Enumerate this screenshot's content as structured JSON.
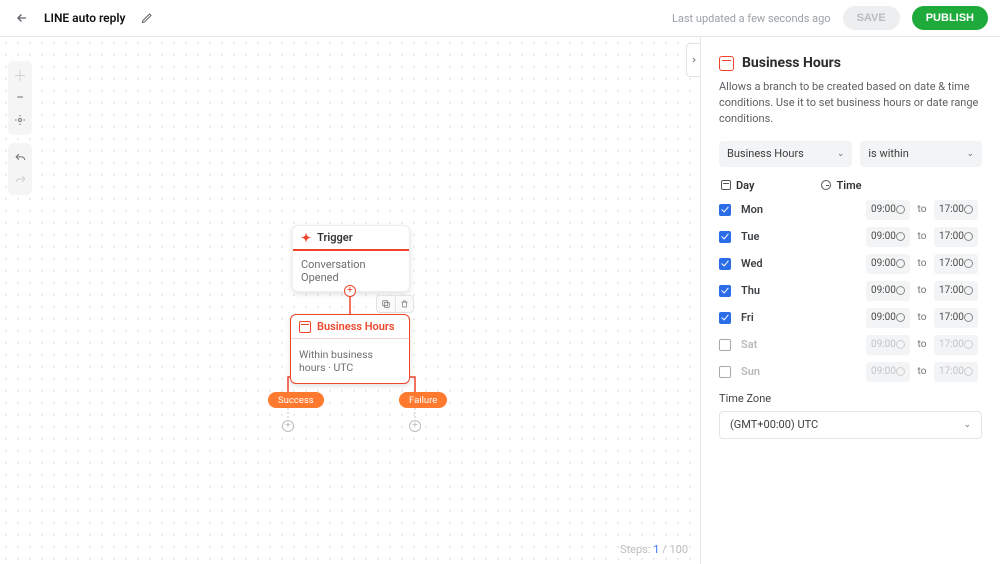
{
  "header": {
    "title": "LINE auto reply",
    "last_updated": "Last updated a few seconds ago",
    "save_label": "SAVE",
    "publish_label": "PUBLISH"
  },
  "canvas": {
    "trigger": {
      "label": "Trigger",
      "body": "Conversation Opened"
    },
    "business": {
      "label": "Business Hours",
      "body": "Within business hours · UTC"
    },
    "success_label": "Success",
    "failure_label": "Failure",
    "steps_prefix": "Steps: ",
    "steps_current": "1",
    "steps_sep": " / ",
    "steps_total": "100"
  },
  "panel": {
    "title": "Business Hours",
    "description": "Allows a branch to be created based on date & time conditions. Use it to set business hours or date range conditions.",
    "select_type": "Business Hours",
    "select_cond": "is within",
    "day_header": "Day",
    "time_header": "Time",
    "to": "to",
    "timezone_label": "Time Zone",
    "timezone_value": "(GMT+00:00) UTC",
    "days": [
      {
        "name": "Mon",
        "checked": true,
        "from": "09:00",
        "to": "17:00"
      },
      {
        "name": "Tue",
        "checked": true,
        "from": "09:00",
        "to": "17:00"
      },
      {
        "name": "Wed",
        "checked": true,
        "from": "09:00",
        "to": "17:00"
      },
      {
        "name": "Thu",
        "checked": true,
        "from": "09:00",
        "to": "17:00"
      },
      {
        "name": "Fri",
        "checked": true,
        "from": "09:00",
        "to": "17:00"
      },
      {
        "name": "Sat",
        "checked": false,
        "from": "09:00",
        "to": "17:00"
      },
      {
        "name": "Sun",
        "checked": false,
        "from": "09:00",
        "to": "17:00"
      }
    ]
  }
}
